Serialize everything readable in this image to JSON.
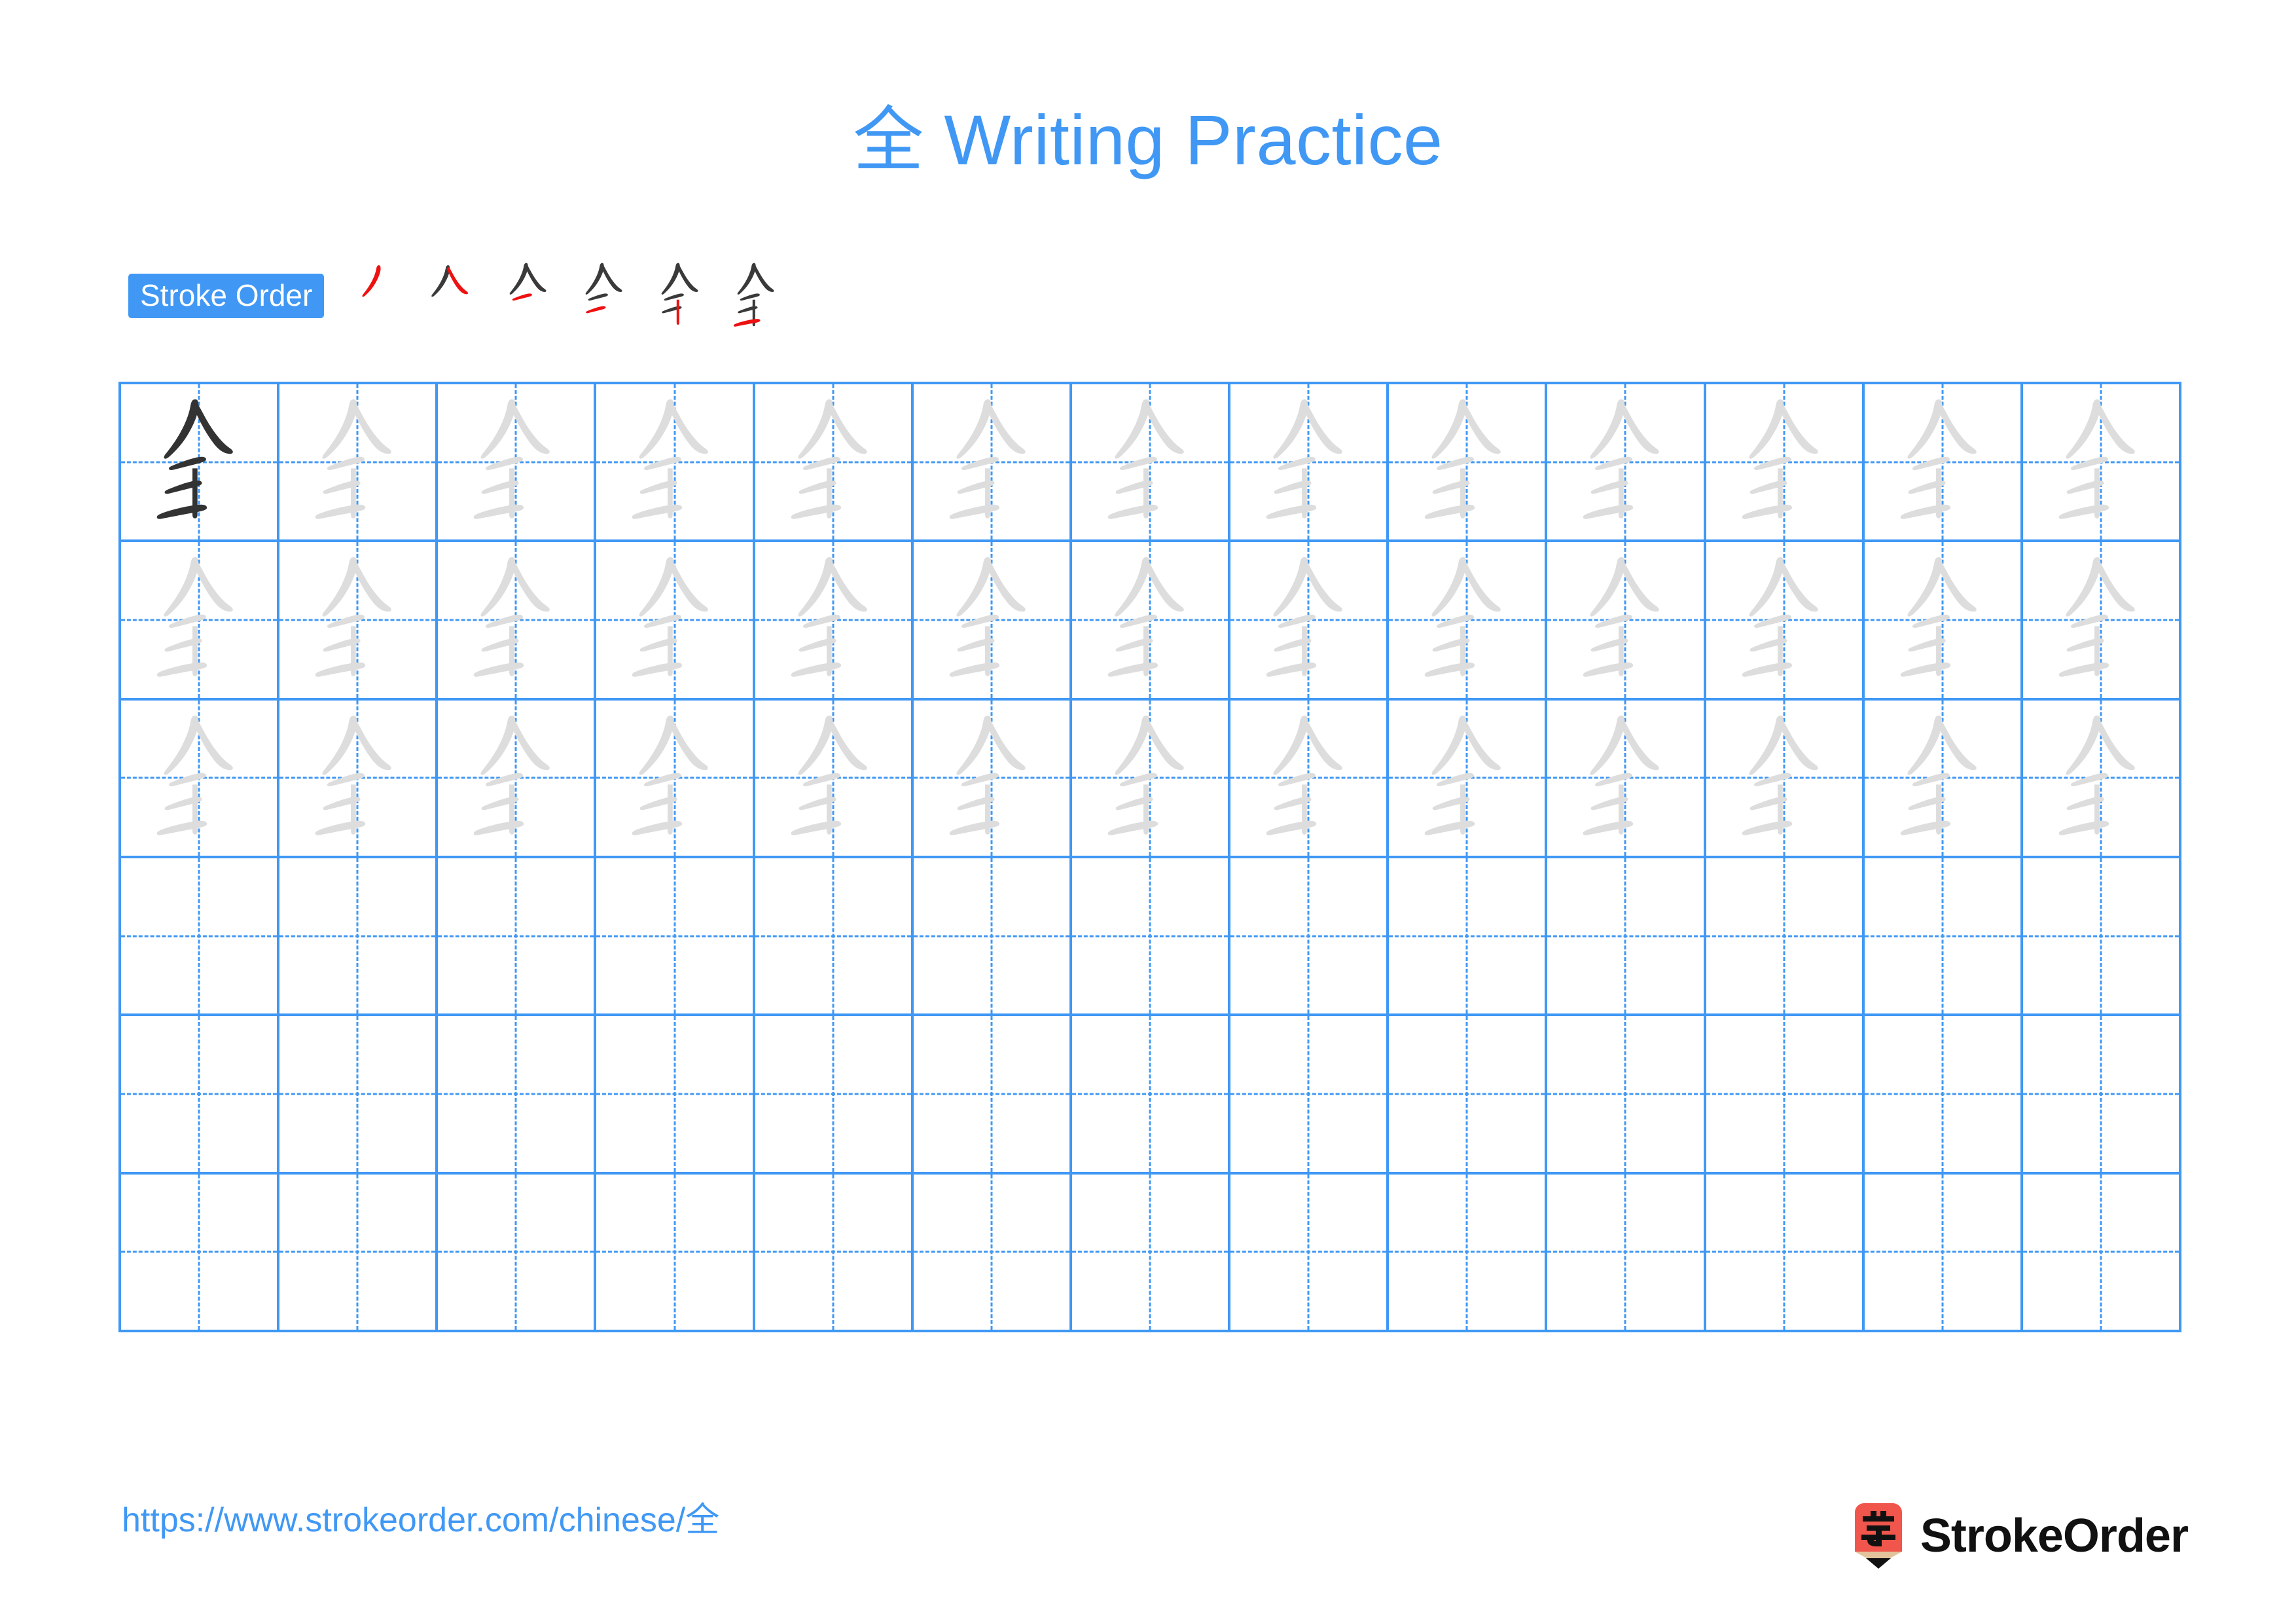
{
  "page": {
    "character": "全",
    "title": "全 Writing Practice",
    "title_suffix": " Writing Practice",
    "background_color": "#FFFFFF",
    "accent_color": "#4098F4",
    "new_stroke_color": "#EE1111",
    "existing_stroke_color": "#3A3A3A",
    "trace_glyph_color": "#DDDDDD",
    "model_glyph_color": "#333333"
  },
  "stroke_order": {
    "label": "Stroke Order",
    "total_strokes": 6,
    "steps": [
      {
        "index": 1,
        "name": "stroke-step-1",
        "new_stroke": "撇 (piě)",
        "strokes_shown": 1
      },
      {
        "index": 2,
        "name": "stroke-step-2",
        "new_stroke": "捺 (nà)",
        "strokes_shown": 2
      },
      {
        "index": 3,
        "name": "stroke-step-3",
        "new_stroke": "横 (héng)",
        "strokes_shown": 3
      },
      {
        "index": 4,
        "name": "stroke-step-4",
        "new_stroke": "横 (héng)",
        "strokes_shown": 4
      },
      {
        "index": 5,
        "name": "stroke-step-5",
        "new_stroke": "竖 (shù)",
        "strokes_shown": 5
      },
      {
        "index": 6,
        "name": "stroke-step-6",
        "new_stroke": "横 (héng)",
        "strokes_shown": 6
      }
    ]
  },
  "practice_grid": {
    "columns": 13,
    "rows": 6,
    "cells": [
      "model",
      "trace",
      "trace",
      "trace",
      "trace",
      "trace",
      "trace",
      "trace",
      "trace",
      "trace",
      "trace",
      "trace",
      "trace",
      "trace",
      "trace",
      "trace",
      "trace",
      "trace",
      "trace",
      "trace",
      "trace",
      "trace",
      "trace",
      "trace",
      "trace",
      "trace",
      "trace",
      "trace",
      "trace",
      "trace",
      "trace",
      "trace",
      "trace",
      "trace",
      "trace",
      "trace",
      "trace",
      "trace",
      "trace",
      "empty",
      "empty",
      "empty",
      "empty",
      "empty",
      "empty",
      "empty",
      "empty",
      "empty",
      "empty",
      "empty",
      "empty",
      "empty",
      "empty",
      "empty",
      "empty",
      "empty",
      "empty",
      "empty",
      "empty",
      "empty",
      "empty",
      "empty",
      "empty",
      "empty",
      "empty",
      "empty",
      "empty",
      "empty",
      "empty",
      "empty",
      "empty",
      "empty",
      "empty",
      "empty",
      "empty",
      "empty",
      "empty",
      "empty"
    ]
  },
  "footer": {
    "url": "https://www.strokeorder.com/chinese/全",
    "brand_name": "StrokeOrder",
    "brand_mark_character": "字",
    "brand_mark_color": "#F0564C",
    "brand_mark_wood_color": "#E2C39C"
  }
}
